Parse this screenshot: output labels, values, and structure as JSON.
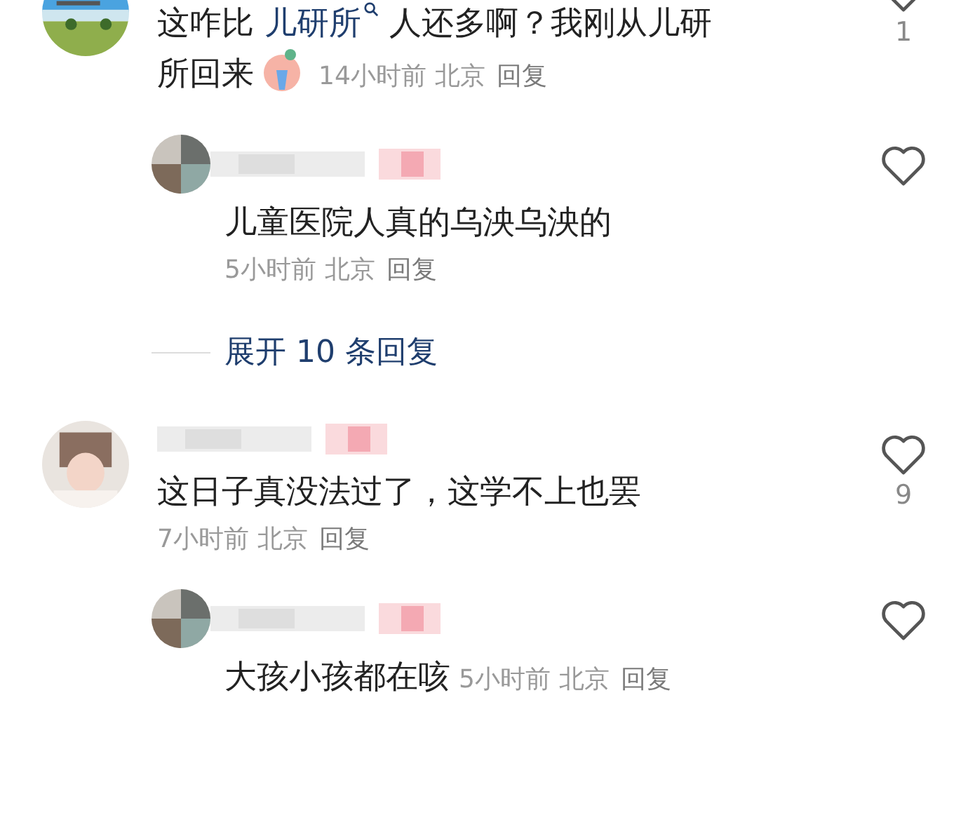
{
  "comments": [
    {
      "parts": [
        {
          "kind": "text",
          "text": "这咋比 "
        },
        {
          "kind": "link",
          "text": "儿研所"
        },
        {
          "kind": "text",
          "text": " 人还多啊？我刚从儿研"
        },
        {
          "kind": "text",
          "text": "所回来"
        },
        {
          "kind": "emoji"
        }
      ],
      "time": "14小时前",
      "location": "北京",
      "reply": "回复",
      "likes": "1",
      "meta_inline": true,
      "cut_top": true,
      "replies": [
        {
          "parts": [
            {
              "kind": "text",
              "text": "儿童医院人真的乌泱乌泱的"
            }
          ],
          "time": "5小时前",
          "location": "北京",
          "reply": "回复",
          "meta_inline": false
        }
      ],
      "expand": "展开 10 条回复"
    },
    {
      "parts": [
        {
          "kind": "text",
          "text": "这日子真没法过了，这学不上也罢"
        }
      ],
      "time": "7小时前",
      "location": "北京",
      "reply": "回复",
      "likes": "9",
      "meta_inline": false,
      "cut_top": false,
      "replies": [
        {
          "parts": [
            {
              "kind": "text",
              "text": "大孩小孩都在咳"
            }
          ],
          "time": "5小时前",
          "location": "北京",
          "reply": "回复",
          "meta_inline": true
        }
      ]
    }
  ]
}
